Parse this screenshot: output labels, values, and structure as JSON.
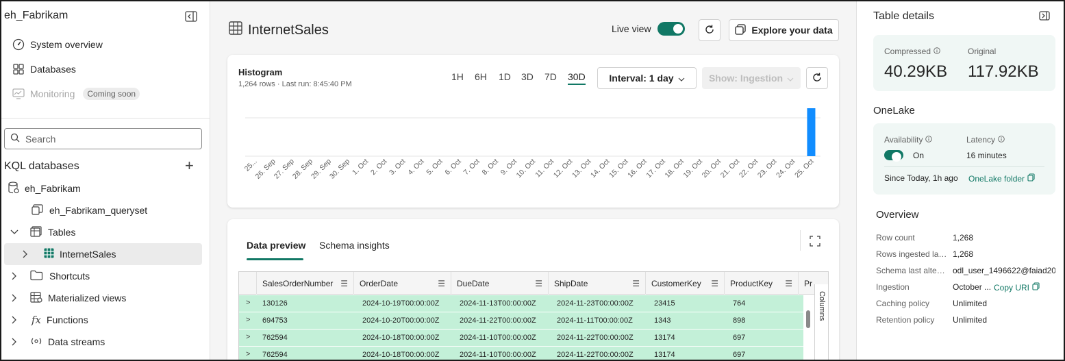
{
  "sidebar": {
    "workspace_title": "eh_Fabrikam",
    "nav": [
      {
        "label": "System overview",
        "icon": "gauge-icon"
      },
      {
        "label": "Databases",
        "icon": "grid-icon"
      },
      {
        "label": "Monitoring",
        "icon": "monitor-icon",
        "badge": "Coming soon"
      }
    ],
    "search_placeholder": "Search",
    "kql_header": "KQL databases",
    "tree": [
      {
        "label": "eh_Fabrikam",
        "icon": "database-icon"
      },
      {
        "label": "eh_Fabrikam_queryset",
        "icon": "queryset-icon"
      },
      {
        "label": "Tables",
        "icon": "tables-icon"
      },
      {
        "label": "InternetSales",
        "icon": "table-icon"
      },
      {
        "label": "Shortcuts",
        "icon": "folder-link-icon"
      },
      {
        "label": "Materialized views",
        "icon": "materialized-view-icon"
      },
      {
        "label": "Functions",
        "icon": "function-icon"
      },
      {
        "label": "Data streams",
        "icon": "stream-icon"
      }
    ]
  },
  "header": {
    "title": "InternetSales",
    "live_view_label": "Live view",
    "live_view_on": true,
    "explore_label": "Explore your data"
  },
  "histogram": {
    "title": "Histogram",
    "subtitle": "1,264 rows · Last run: 8:45:40 PM",
    "ranges": [
      "1H",
      "6H",
      "1D",
      "3D",
      "7D",
      "30D"
    ],
    "active_range": "30D",
    "interval_label": "Interval: 1 day",
    "show_label": "Show: Ingestion",
    "bar_color": "#118dff"
  },
  "chart_data": {
    "type": "bar",
    "categories": [
      "25...",
      "26. Sep",
      "27. Sep",
      "28. Sep",
      "29. Sep",
      "30. Sep",
      "1. Oct",
      "2. Oct",
      "3. Oct",
      "4. Oct",
      "5. Oct",
      "6. Oct",
      "7. Oct",
      "8. Oct",
      "9. Oct",
      "10. Oct",
      "11. Oct",
      "12. Oct",
      "13. Oct",
      "14. Oct",
      "15. Oct",
      "16. Oct",
      "17. Oct",
      "18. Oct",
      "19. Oct",
      "20. Oct",
      "21. Oct",
      "22. Oct",
      "23. Oct",
      "24. Oct",
      "25. Oct"
    ],
    "values": [
      0,
      0,
      0,
      0,
      0,
      0,
      0,
      0,
      0,
      0,
      0,
      0,
      0,
      0,
      0,
      0,
      0,
      0,
      0,
      0,
      0,
      0,
      0,
      0,
      0,
      0,
      0,
      0,
      0,
      0,
      1264
    ],
    "ylim": [
      0,
      1100
    ],
    "grid": true
  },
  "preview": {
    "tabs": [
      "Data preview",
      "Schema insights"
    ],
    "active_tab": "Data preview",
    "columns": [
      "SalesOrderNumber",
      "OrderDate",
      "DueDate",
      "ShipDate",
      "CustomerKey",
      "ProductKey",
      "Pr"
    ],
    "rows": [
      [
        "130126",
        "2024-10-19T00:00:00Z",
        "2024-11-13T00:00:00Z",
        "2024-11-23T00:00:00Z",
        "23415",
        "764"
      ],
      [
        "694753",
        "2024-10-20T00:00:00Z",
        "2024-11-22T00:00:00Z",
        "2024-11-11T00:00:00Z",
        "1343",
        "898"
      ],
      [
        "762594",
        "2024-10-18T00:00:00Z",
        "2024-11-10T00:00:00Z",
        "2024-11-22T00:00:00Z",
        "13174",
        "697"
      ],
      [
        "762594",
        "2024-10-18T00:00:00Z",
        "2024-11-10T00:00:00Z",
        "2024-11-22T00:00:00Z",
        "13174",
        "697"
      ]
    ],
    "columns_panel_label": "Columns",
    "row_color": "#c3f0d8"
  },
  "details": {
    "title": "Table details",
    "compressed_label": "Compressed",
    "compressed_value": "40.29KB",
    "original_label": "Original",
    "original_value": "117.92KB",
    "onelake_title": "OneLake",
    "availability_label": "Availability",
    "availability_value": "On",
    "latency_label": "Latency",
    "latency_value": "16 minutes",
    "since_label": "Since Today, 1h ago",
    "onelake_folder_label": "OneLake folder",
    "overview_title": "Overview",
    "overview": [
      {
        "key": "Row count",
        "value": "1,268"
      },
      {
        "key": "Rows ingested las...",
        "value": "1,268"
      },
      {
        "key": "Schema last altere...",
        "value": "odl_user_1496622@faiad20..."
      },
      {
        "key": "Ingestion",
        "value": "October ...",
        "link": "Copy URI"
      },
      {
        "key": "Caching policy",
        "value": "Unlimited"
      },
      {
        "key": "Retention policy",
        "value": "Unlimited"
      }
    ]
  },
  "colors": {
    "accent": "#117865",
    "light_panel": "#f0f7f5"
  }
}
